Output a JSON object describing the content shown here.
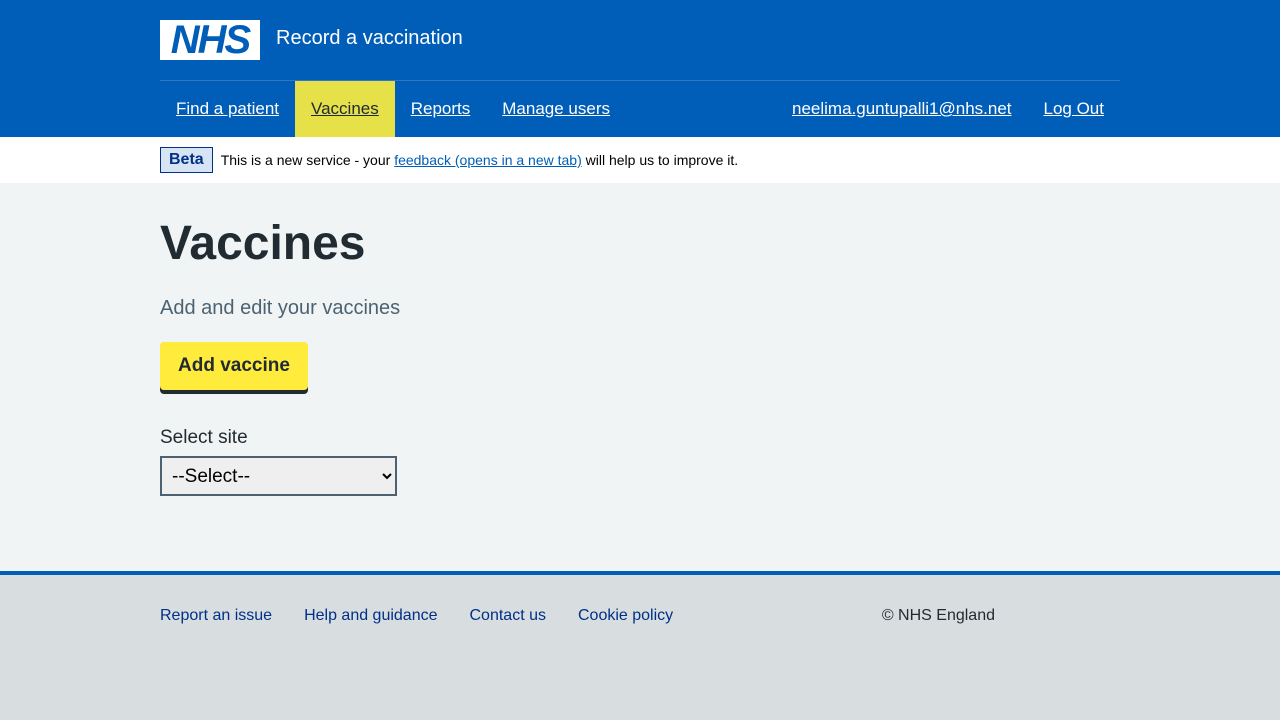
{
  "header": {
    "logo_text": "NHS",
    "service_name": "Record a vaccination",
    "brand_color": "#005eb8"
  },
  "nav": {
    "items": [
      {
        "label": "Find a patient",
        "active": false
      },
      {
        "label": "Vaccines",
        "active": true
      },
      {
        "label": "Reports",
        "active": false
      },
      {
        "label": "Manage users",
        "active": false
      }
    ],
    "user_email": "neelima.guntupalli1@nhs.net",
    "logout_label": "Log Out",
    "active_color": "#e6e049"
  },
  "beta": {
    "tag": "Beta",
    "text_before": "This is a new service - your ",
    "link_text": "feedback (opens in a new tab)",
    "text_after": " will help us to improve it."
  },
  "main": {
    "title": "Vaccines",
    "lead": "Add and edit your vaccines",
    "add_button_label": "Add vaccine",
    "button_color": "#ffeb3b",
    "site_label": "Select site",
    "site_select_value": "--Select--"
  },
  "footer": {
    "links": [
      "Report an issue",
      "Help and guidance",
      "Contact us",
      "Cookie policy"
    ],
    "copyright": "© NHS England"
  }
}
